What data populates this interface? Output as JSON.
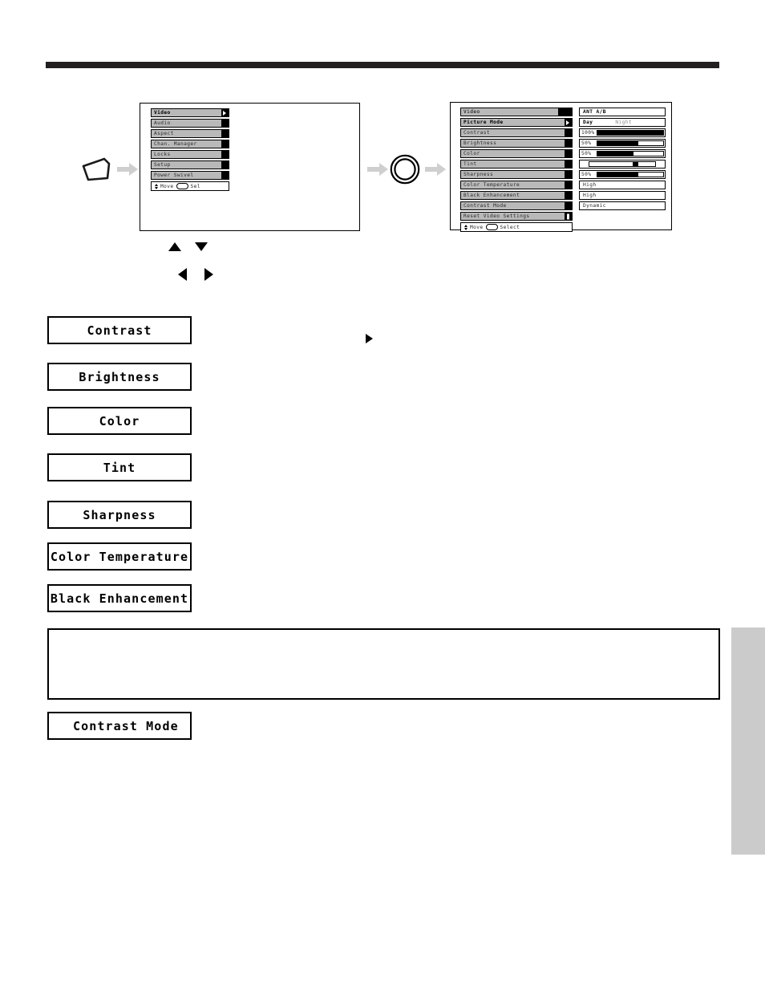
{
  "page": {
    "background": "#ffffff",
    "rule_color": "#231f20",
    "edge_tab_color": "#cbcbcb"
  },
  "diagram": {
    "remote_key_icon": "remote-button-icon",
    "select_ring_icon": "select-ring-icon",
    "flow_arrow_icon": "flow-arrow-icon",
    "arrow_color": "#cfcfcf",
    "direction_glyphs": [
      {
        "name": "arrow-up-glyph",
        "direction": "up"
      },
      {
        "name": "arrow-down-glyph",
        "direction": "down"
      },
      {
        "name": "arrow-left-glyph",
        "direction": "left"
      },
      {
        "name": "arrow-right-glyph",
        "direction": "right"
      }
    ],
    "inline_marker_icon": "right-triangle-marker"
  },
  "osd_main_menu": {
    "items": [
      {
        "label": "Video",
        "selected": true,
        "cap": "arrow"
      },
      {
        "label": "Audio",
        "selected": false,
        "cap": "plain"
      },
      {
        "label": "Aspect",
        "selected": false,
        "cap": "plain"
      },
      {
        "label": "Chan. Manager",
        "selected": false,
        "cap": "plain"
      },
      {
        "label": "Locks",
        "selected": false,
        "cap": "plain"
      },
      {
        "label": "Setup",
        "selected": false,
        "cap": "plain"
      },
      {
        "label": "Power Swivel",
        "selected": false,
        "cap": "plain"
      }
    ],
    "hint_move": "Move",
    "hint_select": "Sel"
  },
  "osd_video_menu": {
    "title": "Video",
    "items": [
      {
        "label": "Picture Mode",
        "selected": true,
        "cap": "arrow"
      },
      {
        "label": "Contrast",
        "selected": false,
        "cap": "plain"
      },
      {
        "label": "Brightness",
        "selected": false,
        "cap": "plain"
      },
      {
        "label": "Color",
        "selected": false,
        "cap": "plain"
      },
      {
        "label": "Tint",
        "selected": false,
        "cap": "plain"
      },
      {
        "label": "Sharpness",
        "selected": false,
        "cap": "plain"
      },
      {
        "label": "Color Temperature",
        "selected": false,
        "cap": "plain"
      },
      {
        "label": "Black Enhancement",
        "selected": false,
        "cap": "plain"
      },
      {
        "label": "Contrast Mode",
        "selected": false,
        "cap": "plain"
      },
      {
        "label": "Reset Video Settings",
        "selected": false,
        "cap": "scroll"
      }
    ],
    "hint_move": "Move",
    "hint_select": "Select",
    "values": [
      {
        "kind": "text",
        "text": "ANT A/B"
      },
      {
        "kind": "toggle",
        "option_on": "Day",
        "option_off": "Night"
      },
      {
        "kind": "bar",
        "percent_label": "100%",
        "fill": 100
      },
      {
        "kind": "bar",
        "percent_label": "50%",
        "fill": 62
      },
      {
        "kind": "bar",
        "percent_label": "50%",
        "fill": 55
      },
      {
        "kind": "tint",
        "percent_label": "",
        "knob": 72
      },
      {
        "kind": "bar",
        "percent_label": "50%",
        "fill": 62
      },
      {
        "kind": "text",
        "text": "High"
      },
      {
        "kind": "text",
        "text": "High"
      },
      {
        "kind": "text",
        "text": "Dynamic"
      }
    ]
  },
  "captions": [
    {
      "name": "caption-contrast",
      "text": "Contrast"
    },
    {
      "name": "caption-brightness",
      "text": "Brightness"
    },
    {
      "name": "caption-color",
      "text": "Color"
    },
    {
      "name": "caption-tint",
      "text": "Tint"
    },
    {
      "name": "caption-sharpness",
      "text": "Sharpness"
    },
    {
      "name": "caption-color-temperature",
      "text": "Color Temperature"
    },
    {
      "name": "caption-black-enhancement",
      "text": "Black Enhancement"
    },
    {
      "name": "caption-contrast-mode",
      "text": "Contrast Mode"
    }
  ]
}
